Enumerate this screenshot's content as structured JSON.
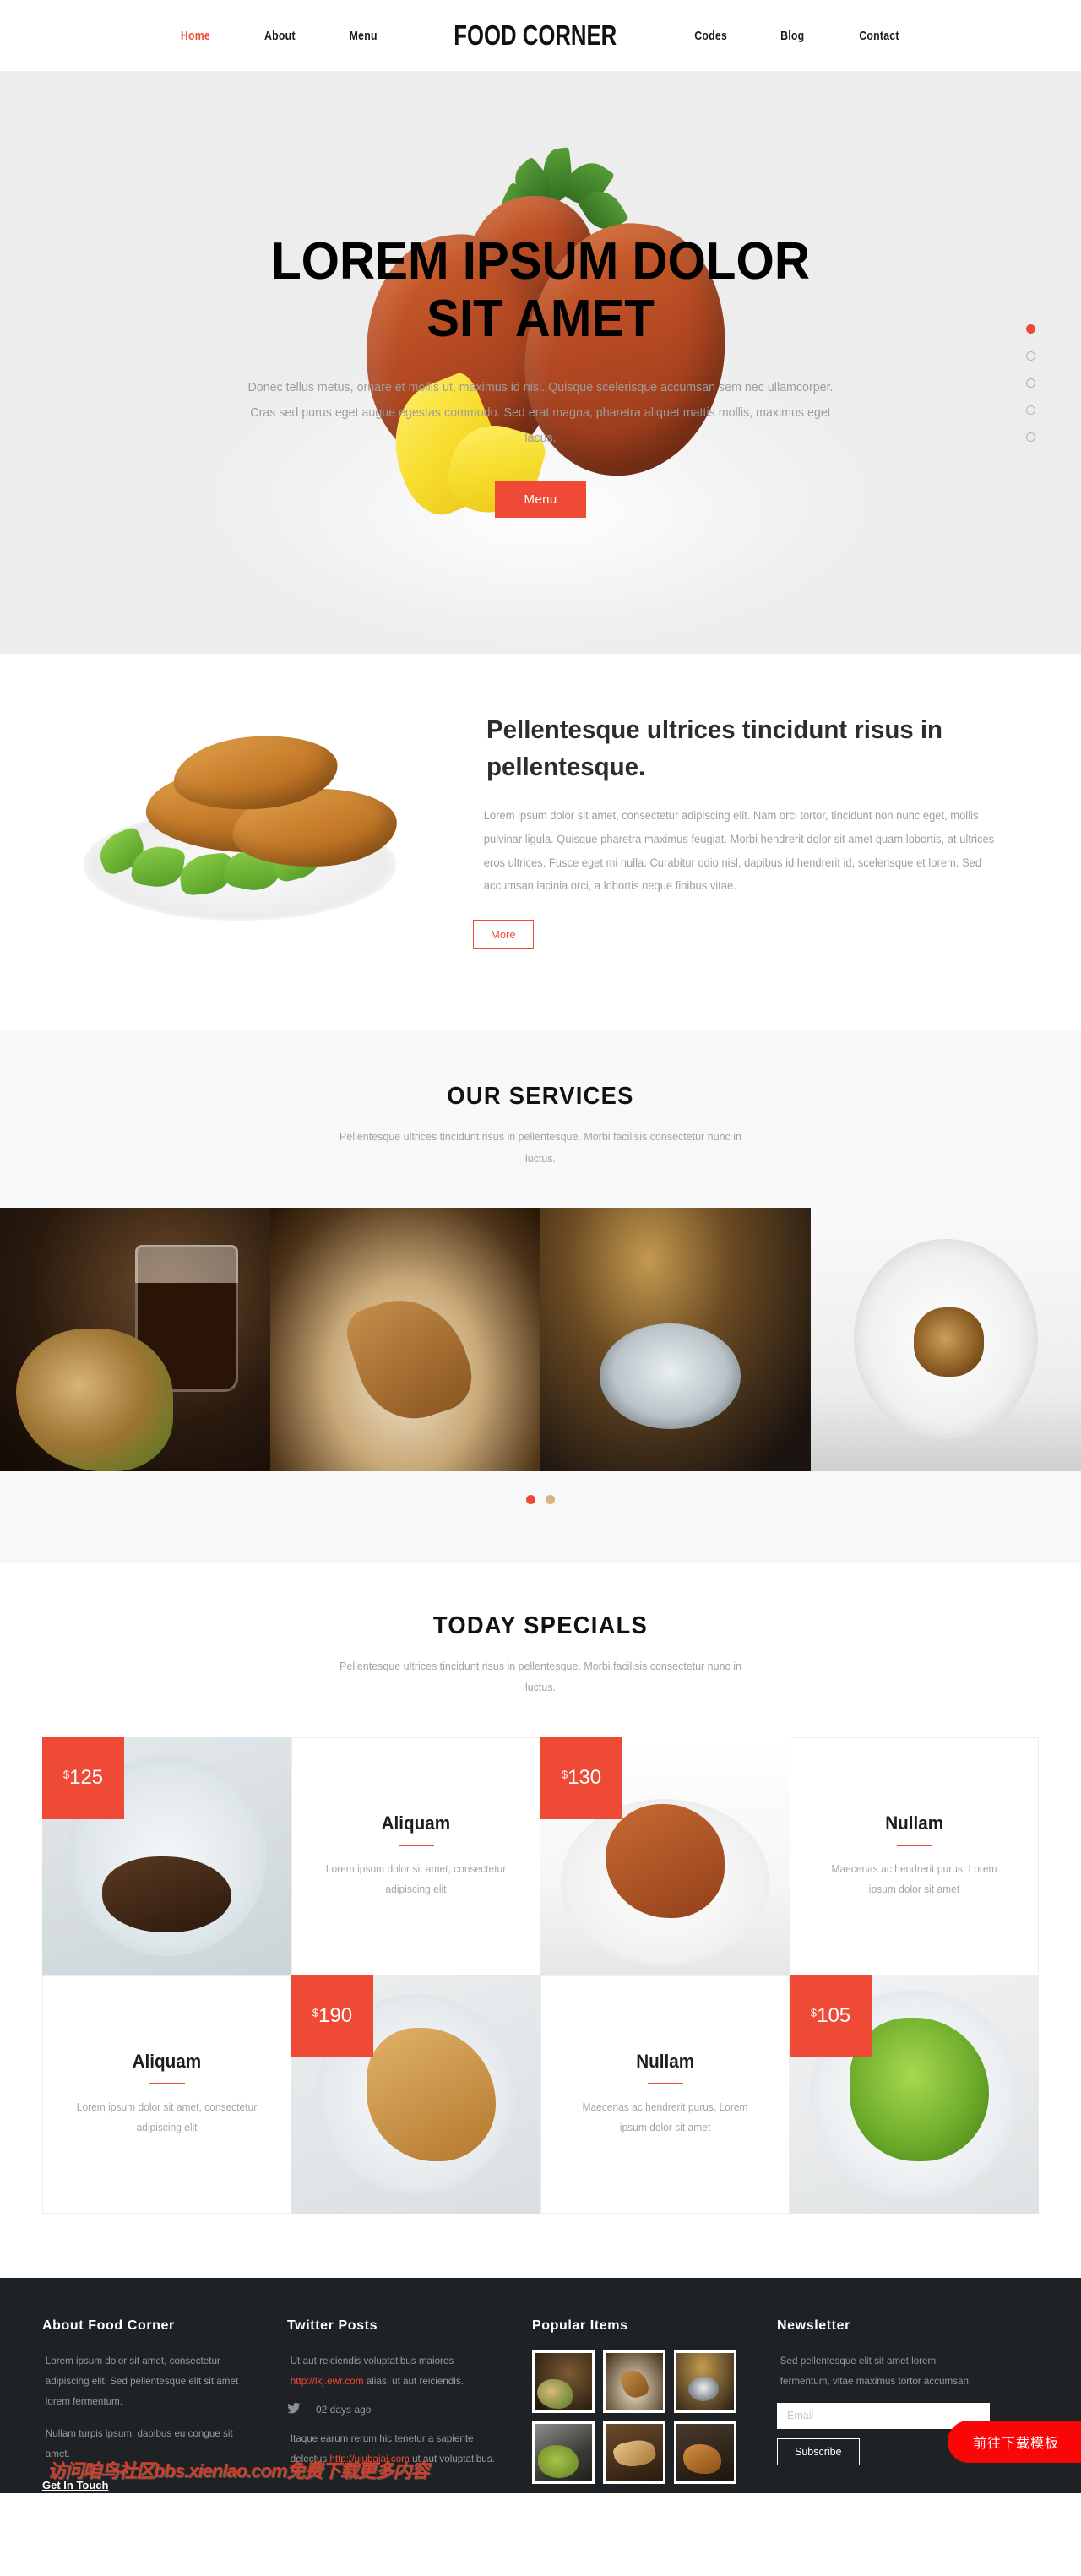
{
  "header": {
    "nav_left": [
      {
        "label": "Home",
        "active": true
      },
      {
        "label": "About",
        "active": false
      },
      {
        "label": "Menu",
        "active": false
      }
    ],
    "brand": "FOOD CORNER",
    "nav_right": [
      {
        "label": "Codes"
      },
      {
        "label": "Blog"
      },
      {
        "label": "Contact"
      }
    ]
  },
  "hero": {
    "title_line1": "LOREM IPSUM DOLOR",
    "title_line2": "SIT AMET",
    "subtitle": "Donec tellus metus, ornare et mollis ut, maximus id nisi. Quisque scelerisque accumsan sem nec ullamcorper. Cras sed purus eget augue egestas commodo. Sed erat magna, pharetra aliquet mattis mollis, maximus eget lacus.",
    "button_label": "Menu",
    "dots_total": 5,
    "dot_active": 0,
    "accent_color": "#ef4a35"
  },
  "about": {
    "heading": "Pellentesque ultrices tincidunt risus in pellentesque.",
    "paragraph": "Lorem ipsum dolor sit amet, consectetur adipiscing elit. Nam orci tortor, tincidunt non nunc eget, mollis pulvinar ligula. Quisque pharetra maximus feugiat. Morbi hendrerit dolor sit amet quam lobortis, at ultrices eros ultrices. Fusce eget mi nulla. Curabitur odio nisl, dapibus id hendrerit id, scelerisque et lorem. Sed accumsan lacinia orci, a lobortis neque finibus vitae.",
    "button_label": "More"
  },
  "services": {
    "title": "OUR SERVICES",
    "subtitle": "Pellentesque ultrices tincidunt risus in pellentesque. Morbi facilisis consectetur nunc in luctus.",
    "slides": [
      {
        "name": "sandwich-and-coffee"
      },
      {
        "name": "grilled-chops"
      },
      {
        "name": "restaurant-table-setting"
      },
      {
        "name": "plated-gourmet-dish"
      }
    ],
    "dots_total": 2,
    "dot_active": 0
  },
  "specials": {
    "title": "TODAY SPECIALS",
    "subtitle": "Pellentesque ultrices tincidunt risus in pellentesque. Morbi facilisis consectetur nunc in luctus.",
    "currency": "$",
    "items": [
      {
        "price": "125",
        "name": "Aliquam",
        "desc": "Lorem ipsum dolor sit amet, consectetur adipiscing elit",
        "image": "steak-plate"
      },
      {
        "price": "130",
        "name": "Nullam",
        "desc": "Maecenas ac hendrerit purus. Lorem ipsum dolor sit amet",
        "image": "fried-fish-lemon"
      },
      {
        "price": "190",
        "name": "Aliquam",
        "desc": "Lorem ipsum dolor sit amet, consectetur adipiscing elit",
        "image": "fried-chicken-chili"
      },
      {
        "price": "105",
        "name": "Nullam",
        "desc": "Maecenas ac hendrerit purus. Lorem ipsum dolor sit amet",
        "image": "green-salad"
      }
    ]
  },
  "footer": {
    "about": {
      "heading": "About Food Corner",
      "p1": "Lorem ipsum dolor sit amet, consectetur adipiscing elit. Sed pellentesque elit sit amet lorem fermentum.",
      "p2": "Nullam turpis ipsum, dapibus eu congue sit amet.",
      "cta": "Get In Touch"
    },
    "twitter": {
      "heading": "Twitter Posts",
      "post1_pre": "Ut aut reiciendis voluptatibus maiores ",
      "post1_link": "http://lkj.ewr.com",
      "post1_post": " alias, ut aut reiciendis.",
      "icon": "twitter-icon",
      "ago": "02 days ago",
      "post2_pre": "Itaque earum rerum hic tenetur a sapiente delectus ",
      "post2_link": "http://uiubajaj.com",
      "post2_post": " ut aut voluptatibus."
    },
    "popular": {
      "heading": "Popular Items",
      "thumbs": [
        {
          "name": "sandwich-coffee-thumb"
        },
        {
          "name": "lamb-chop-thumb"
        },
        {
          "name": "table-setting-thumb"
        },
        {
          "name": "grilled-veg-thumb"
        },
        {
          "name": "skewers-thumb"
        },
        {
          "name": "fried-wings-thumb"
        }
      ]
    },
    "newsletter": {
      "heading": "Newsletter",
      "text": "Sed pellentesque elit sit amet lorem fermentum, vitae maximus tortor accumsan.",
      "input_placeholder": "Email",
      "input_value": "",
      "button_label": "Subscribe"
    },
    "watermark": "访问咱鸟社区bbs.xienlao.com免费下载更多内容",
    "download_badge": "前往下载模板"
  }
}
